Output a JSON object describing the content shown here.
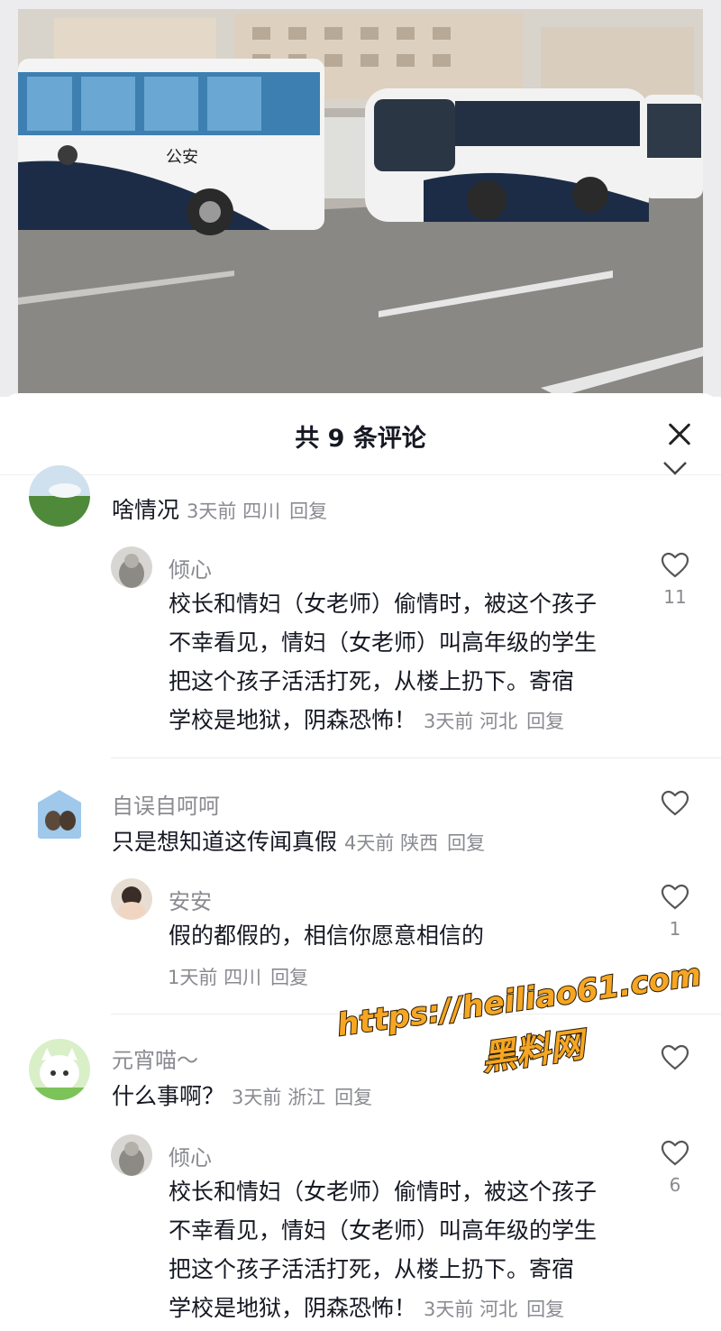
{
  "video": {
    "bus_label": "公安"
  },
  "sheet": {
    "title": "共 9 条评论"
  },
  "comments": [
    {
      "text": "啥情况",
      "time": "3天前",
      "location": "四川",
      "reply": "回复",
      "replies": [
        {
          "user": "倾心",
          "lines": [
            "校长和情妇（女老师）偷情时，被这个孩子",
            "不幸看见，情妇（女老师）叫高年级的学生",
            "把这个孩子活活打死，从楼上扔下。寄宿",
            "学校是地狱，阴森恐怖！"
          ],
          "time": "3天前",
          "location": "河北",
          "reply": "回复",
          "likes": "11"
        }
      ]
    },
    {
      "user": "自误自呵呵",
      "text": "只是想知道这传闻真假",
      "time": "4天前",
      "location": "陕西",
      "reply": "回复",
      "replies": [
        {
          "user": "安安",
          "lines": [
            "假的都假的，相信你愿意相信的"
          ],
          "time": "1天前",
          "location": "四川",
          "reply": "回复",
          "likes": "1"
        }
      ]
    },
    {
      "user": "元宵喵～",
      "text": "什么事啊？",
      "time": "3天前",
      "location": "浙江",
      "reply": "回复",
      "replies": [
        {
          "user": "倾心",
          "lines": [
            "校长和情妇（女老师）偷情时，被这个孩子",
            "不幸看见，情妇（女老师）叫高年级的学生",
            "把这个孩子活活打死，从楼上扔下。寄宿",
            "学校是地狱，阴森恐怖！"
          ],
          "time": "3天前",
          "location": "河北",
          "reply": "回复",
          "likes": "6"
        }
      ]
    }
  ],
  "watermark": {
    "url": "https://heiliao61.com",
    "name": "黑料网"
  }
}
